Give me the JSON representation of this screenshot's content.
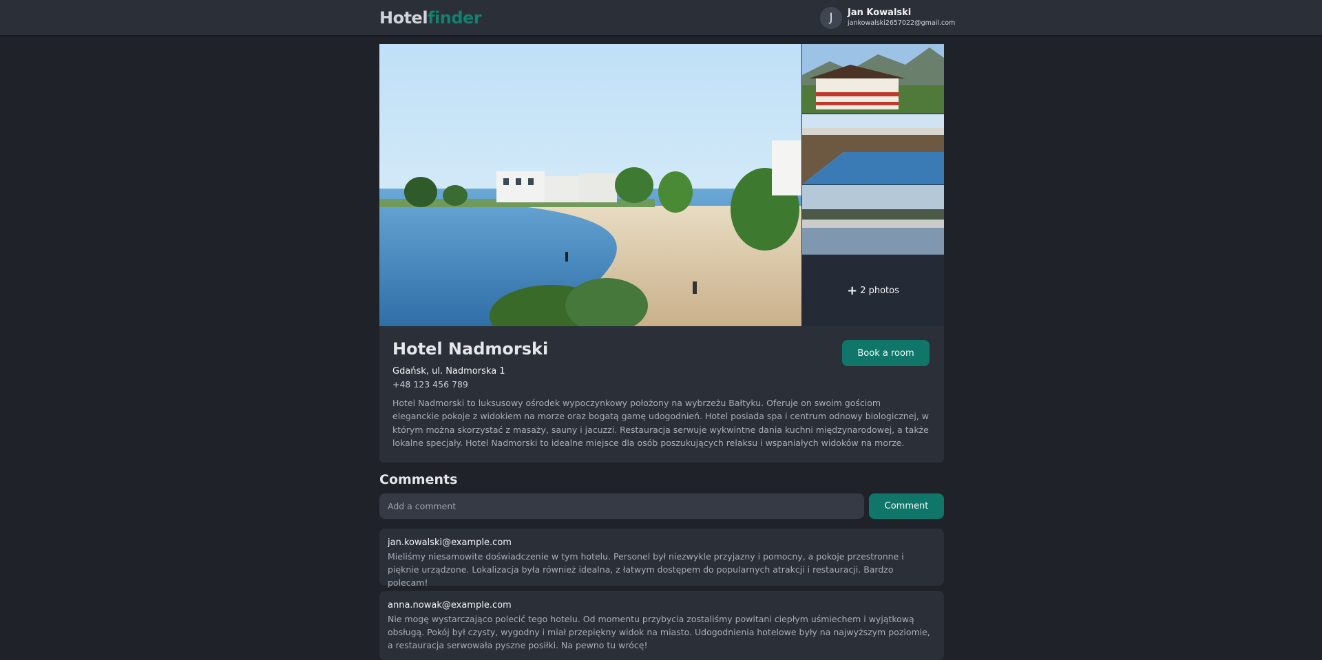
{
  "header": {
    "logo_part1": "Hotel",
    "logo_part2": "finder",
    "user": {
      "initial": "J",
      "name": "Jan Kowalski",
      "email": "jankowalski2657022@gmail.com"
    }
  },
  "gallery": {
    "more_photos_label": "2 photos",
    "more_icon": "plus-icon"
  },
  "hotel": {
    "name": "Hotel Nadmorski",
    "address": "Gdańsk, ul. Nadmorska 1",
    "phone": "+48 123 456 789",
    "description": "Hotel Nadmorski to luksusowy ośrodek wypoczynkowy położony na wybrzeżu Bałtyku. Oferuje on swoim gościom eleganckie pokoje z widokiem na morze oraz bogatą gamę udogodnień. Hotel posiada spa i centrum odnowy biologicznej, w którym można skorzystać z masaży, sauny i jacuzzi. Restauracja serwuje wykwintne dania kuchni międzynarodowej, a także lokalne specjały. Hotel Nadmorski to idealne miejsce dla osób poszukujących relaksu i wspaniałych widoków na morze.",
    "book_label": "Book a room"
  },
  "comments": {
    "title": "Comments",
    "input_placeholder": "Add a comment",
    "submit_label": "Comment",
    "items": [
      {
        "author": "jan.kowalski@example.com",
        "text": "Mieliśmy niesamowite doświadczenie w tym hotelu. Personel był niezwykle przyjazny i pomocny, a pokoje przestronne i pięknie urządzone. Lokalizacja była również idealna, z łatwym dostępem do popularnych atrakcji i restauracji. Bardzo polecam!"
      },
      {
        "author": "anna.nowak@example.com",
        "text": "Nie mogę wystarczająco polecić tego hotelu. Od momentu przybycia zostaliśmy powitani ciepłym uśmiechem i wyjątkową obsługą. Pokój był czysty, wygodny i miał przepiękny widok na miasto. Udogodnienia hotelowe były na najwyższym poziomie, a restauracja serwowała pyszne posiłki. Na pewno tu wrócę!"
      }
    ]
  },
  "colors": {
    "background": "#1f2229",
    "surface": "#2b2f38",
    "accent": "#11766a",
    "logo_accent": "#14806f"
  }
}
